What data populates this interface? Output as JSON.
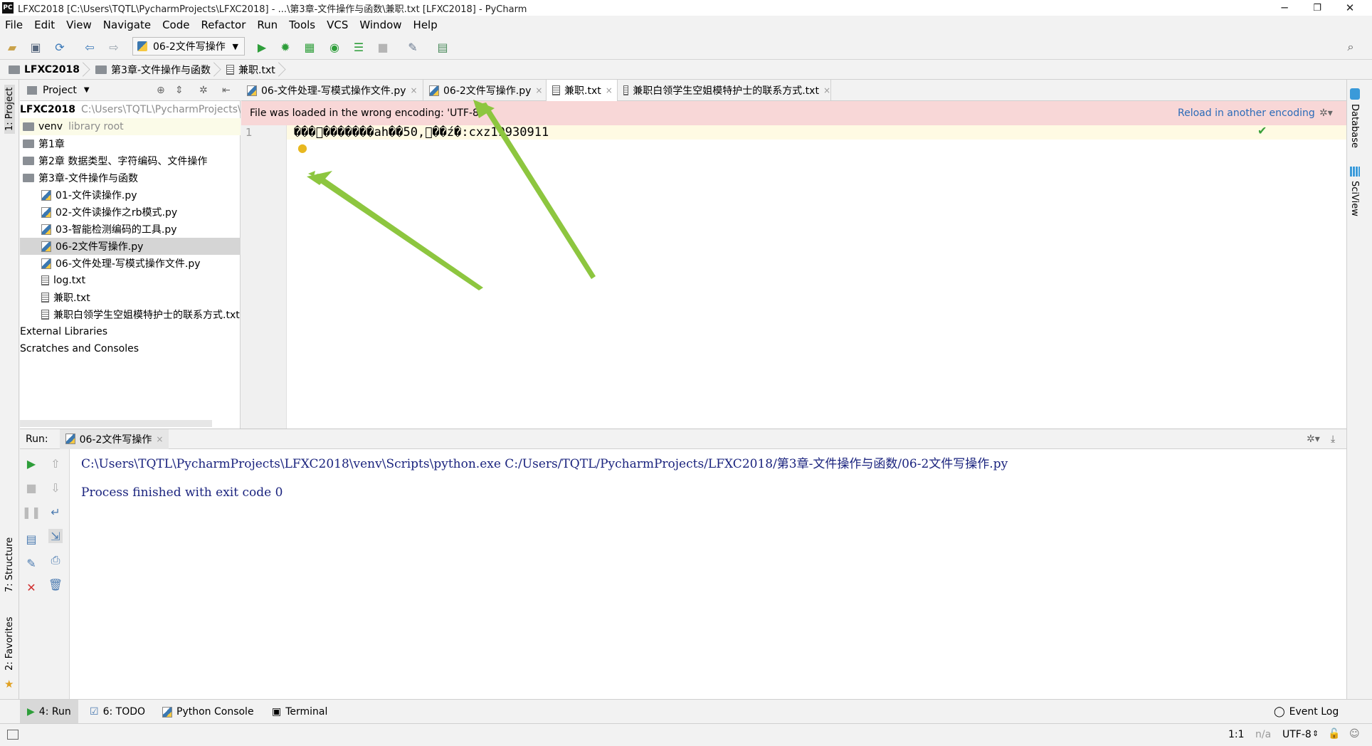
{
  "window": {
    "title": "LFXC2018 [C:\\Users\\TQTL\\PycharmProjects\\LFXC2018] - ...\\第3章-文件操作与函数\\兼职.txt [LFXC2018] - PyCharm",
    "app_icon": "PC",
    "minimize": "─",
    "restore": "❐",
    "close": "✕"
  },
  "menu": [
    "File",
    "Edit",
    "View",
    "Navigate",
    "Code",
    "Refactor",
    "Run",
    "Tools",
    "VCS",
    "Window",
    "Help"
  ],
  "toolbar": {
    "run_config": "06-2文件写操作"
  },
  "breadcrumb": [
    "LFXC2018",
    "第3章-文件操作与函数",
    "兼职.txt"
  ],
  "left_stripe": {
    "project": "1: Project",
    "structure": "7: Structure",
    "favorites": "2: Favorites"
  },
  "right_stripe": {
    "database": "Database",
    "sciview": "SciView"
  },
  "project_panel": {
    "header": "Project",
    "root_name": "LFXC2018",
    "root_path": "C:\\Users\\TQTL\\PycharmProjects\\LFX",
    "venv": "venv",
    "venv_note": "library root",
    "items": [
      {
        "label": "第1章",
        "type": "folder",
        "indent": 0
      },
      {
        "label": "第2章 数据类型、字符编码、文件操作",
        "type": "folder",
        "indent": 0
      },
      {
        "label": "第3章-文件操作与函数",
        "type": "folder",
        "indent": 0
      },
      {
        "label": "01-文件读操作.py",
        "type": "py",
        "indent": 1
      },
      {
        "label": "02-文件读操作之rb模式.py",
        "type": "py",
        "indent": 1
      },
      {
        "label": "03-智能检测编码的工具.py",
        "type": "py",
        "indent": 1
      },
      {
        "label": "06-2文件写操作.py",
        "type": "py",
        "indent": 1
      },
      {
        "label": "06-文件处理-写模式操作文件.py",
        "type": "py",
        "indent": 1
      },
      {
        "label": "log.txt",
        "type": "txt",
        "indent": 1
      },
      {
        "label": "兼职.txt",
        "type": "txt",
        "indent": 1
      },
      {
        "label": "兼职白领学生空姐模特护士的联系方式.txt",
        "type": "txt",
        "indent": 1
      }
    ],
    "external": "External Libraries",
    "scratches": "Scratches and Consoles"
  },
  "editor_tabs": [
    {
      "label": "06-文件处理-写模式操作文件.py",
      "close": "×"
    },
    {
      "label": "06-2文件写操作.py",
      "close": "×"
    },
    {
      "label": "兼职.txt",
      "close": "×"
    },
    {
      "label": "兼职白领学生空姐模特护士的联系方式.txt",
      "close": "×"
    }
  ],
  "notification": {
    "message": "File was loaded in the wrong encoding: 'UTF-8'",
    "action": "Reload in another encoding"
  },
  "editor": {
    "line_number": "1",
    "line_text": "���\u0000�������ah��50,\u0000��ź�:cxz19930911"
  },
  "run_panel": {
    "label": "Run:",
    "tab": "06-2文件写操作",
    "command": "C:\\Users\\TQTL\\PycharmProjects\\LFXC2018\\venv\\Scripts\\python.exe C:/Users/TQTL/PycharmProjects/LFXC2018/第3章-文件操作与函数/06-2文件写操作.py",
    "exit_message": "Process finished with exit code 0"
  },
  "bottom_tabs": {
    "run": "4: Run",
    "todo": "6: TODO",
    "python_console": "Python Console",
    "terminal": "Terminal",
    "event_log": "Event Log"
  },
  "status": {
    "position": "1:1",
    "na": "n/a",
    "encoding": "UTF-8"
  },
  "colors": {
    "notification_bg": "#f8d7d7",
    "run_green": "#2e9e3a",
    "link_blue": "#2a6bb8",
    "arrow_green": "#8dc63f"
  }
}
